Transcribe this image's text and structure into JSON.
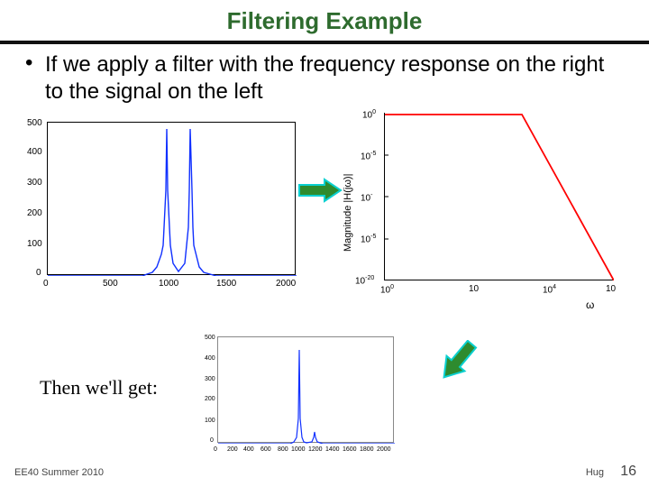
{
  "title": "Filtering Example",
  "bullet": "If we apply a filter with the frequency response on the right to the signal on the left",
  "then": "Then we'll get:",
  "footer": {
    "left": "EE40 Summer 2010",
    "right": "Hug",
    "page": "16"
  },
  "chart_data": [
    {
      "type": "line",
      "title": "",
      "xlabel": "",
      "ylabel": "",
      "xlim": [
        -100,
        2000
      ],
      "ylim": [
        0,
        500
      ],
      "xticks": [
        0,
        500,
        1000,
        1500,
        2000
      ],
      "yticks": [
        0,
        100,
        200,
        300,
        400,
        500
      ],
      "x": [
        -100,
        700,
        740,
        780,
        820,
        860,
        870,
        880,
        890,
        900,
        910,
        920,
        930,
        950,
        1000,
        1050,
        1070,
        1080,
        1090,
        1100,
        1110,
        1120,
        1130,
        1170,
        1210,
        1260,
        1300,
        2000
      ],
      "values": [
        0,
        0,
        5,
        12,
        30,
        70,
        100,
        160,
        280,
        480,
        280,
        160,
        100,
        40,
        15,
        40,
        100,
        160,
        280,
        480,
        280,
        160,
        100,
        30,
        12,
        5,
        0,
        0
      ],
      "color": "#1030ff"
    },
    {
      "type": "line",
      "title": "",
      "xlabel": "ω",
      "ylabel": "Magnitude |H(jω)|",
      "log_x": true,
      "log_y": true,
      "xlim": [
        1,
        100000
      ],
      "ylim": [
        1e-20,
        1
      ],
      "xticks_labels": [
        "10⁰",
        "10",
        "10⁴",
        "10"
      ],
      "yticks_labels": [
        "10⁰",
        "10⁻⁵",
        "10⁻",
        "10⁻⁵",
        "10⁻²⁰"
      ],
      "x": [
        1,
        1000,
        100000
      ],
      "values": [
        1,
        1,
        1e-20
      ],
      "color": "#ff0000"
    },
    {
      "type": "line",
      "title": "",
      "xlabel": "",
      "ylabel": "",
      "xlim": [
        -100,
        2000
      ],
      "ylim": [
        0,
        500
      ],
      "xticks": [
        0,
        200,
        400,
        600,
        800,
        1000,
        1200,
        1400,
        1600,
        1800,
        2000
      ],
      "yticks": [
        0,
        100,
        200,
        300,
        400,
        500
      ],
      "x": [
        -100,
        800,
        840,
        870,
        890,
        900,
        910,
        930,
        960,
        1000,
        1060,
        1090,
        1100,
        1110,
        1140,
        1200,
        2000
      ],
      "values": [
        0,
        0,
        8,
        30,
        120,
        440,
        120,
        30,
        10,
        5,
        10,
        30,
        55,
        30,
        10,
        0,
        0
      ],
      "color": "#1030ff"
    }
  ]
}
